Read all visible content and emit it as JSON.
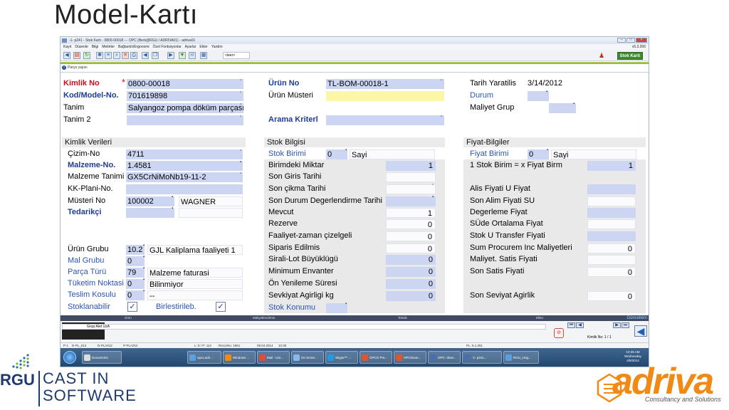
{
  "slide": {
    "title": "Model-Kartı"
  },
  "window": {
    "title": "-1- p241 - Stok Kartı - 0800-00018 --- OPC (Berk@RGU / ADRIVA01) - adriva01",
    "version": "v5.3.266",
    "menus": [
      "Kayıt",
      "Düzenle",
      "Bilgi",
      "Metinler",
      "Bağlantılı/Ergonomi",
      "Özel Fonksiyonlar",
      "Ayarlar",
      "Ekler",
      "Yardım"
    ],
    "toolbar_select": "<leer>",
    "stok_karti_button": "Stok Karti",
    "breadcrumb": "Parça yapısı"
  },
  "header": {
    "kimlik_no_label": "Kimlik No",
    "kimlik_no_req": "*",
    "kimlik_no": "0800-00018",
    "kod_model_label": "Kod/Model-No.",
    "kod_model": "701619898",
    "tanim_label": "Tanim",
    "tanim": "Salyangoz pompa döküm parçası",
    "tanim2_label": "Tanim 2",
    "tanim2": "",
    "urun_no_label": "Ürün No",
    "urun_no": "TL-BOM-00018-1",
    "urun_musteri_label": "Ürün Müsteri",
    "urun_musteri": "",
    "arama_label": "Arama Kriterl",
    "arama": "",
    "tarih_label": "Tarih Yaratilis",
    "tarih": "3/14/2012",
    "durum_label": "Durum",
    "durum": "",
    "maliyet_grup_label": "Maliyet Grup",
    "maliyet_grup": ""
  },
  "kimlik_verileri": {
    "title": "Kimlik Verileri",
    "cizim_label": "Çizim-No",
    "cizim": "4711",
    "malzeme_no_label": "Malzeme-No.",
    "malzeme_no": "1.4581",
    "malzeme_tanim_label": "Malzeme Tanimi",
    "malzeme_tanim": "GX5CrNiMoNb19-11-2",
    "kk_plani_label": "KK-Plani-No.",
    "kk_plani": "",
    "musteri_no_label": "Müsteri No",
    "musteri_no": "100002",
    "musteri_name": "WAGNER",
    "tedarikci_label": "Tedarikçi",
    "tedarikci": "",
    "urun_grubu_label": "Ürün Grubu",
    "urun_grubu_code": "10.2",
    "urun_grubu_desc": "GJL Kaliplama faaliyeti 1",
    "mal_grubu_label": "Mal Grubu",
    "mal_grubu": "0",
    "parca_turu_label": "Parça Türü",
    "parca_turu_code": "79",
    "parca_turu_desc": "Malzeme faturasi",
    "tuketim_label": "Tüketim Noktasi",
    "tuketim_code": "0",
    "tuketim_desc": "Bilinmiyor",
    "teslim_label": "Teslim Kosulu",
    "teslim_code": "0",
    "teslim_desc": "--",
    "stoklanabilir_label": "Stoklanabilir",
    "birlestirileb_label": "Birlestirileb.",
    "check_mark": "✓"
  },
  "stok_bilgisi": {
    "title": "Stok Bilgisi",
    "stok_birimi_label": "Stok Birimi",
    "stok_birimi_code": "0",
    "stok_birimi_desc": "Sayi",
    "rows": [
      {
        "label": "Birimdeki Miktar",
        "value": "1"
      },
      {
        "label": "Son Giris Tarihi",
        "value": ""
      },
      {
        "label": "Son çikma Tarihi",
        "value": ""
      },
      {
        "label": "Son Durum Degerlendirme Tarihi",
        "value": ""
      },
      {
        "label": "Mevcut",
        "value": "1"
      },
      {
        "label": "Rezerve",
        "value": "0"
      },
      {
        "label": "Faaliyet-zaman çizelgeli",
        "value": "0"
      },
      {
        "label": "Siparis Edilmis",
        "value": "0"
      },
      {
        "label": "Sirali-Lot Büyüklügü",
        "value": "0"
      },
      {
        "label": "Minimum Envanter",
        "value": "0"
      },
      {
        "label": "Ön Yenileme  Süresi",
        "value": "0"
      },
      {
        "label": "Sevkiyat Agirligi kg",
        "value": "0"
      }
    ],
    "stok_konumu_label": "Stok Konumu",
    "stok_konumu": ""
  },
  "fiyat_bilgiler": {
    "title": "Fiyat-Bilgiler",
    "fiyat_birimi_label": "Fiyat Birimi",
    "fiyat_birimi_code": "0",
    "fiyat_birimi_desc": "Sayi",
    "stok_fiyat_label": "1 Stok Birim = x Fiyat Birm",
    "stok_fiyat": "1",
    "alis_label": "Alis Fiyati U Fiyat",
    "son_alim_label": "Son Alim Fiyati SU",
    "degerleme_label": "Degerleme Fiyat",
    "sude_label": "SÜde Ortalama Fiyat",
    "transfer_label": "Stok U Transfer Fiyati",
    "sum_procurem_label": "Sum Procurem Inc Maliyetleri",
    "sum_procurem": "0",
    "maliyet_satis_label": "Maliyet. Satis Fiyati",
    "son_satis_label": "Son Satis Fiyati",
    "son_satis": "0",
    "son_sevkiyat_label": "Son Seviyat Agirlik",
    "son_sevkiyat": "0"
  },
  "tabs": {
    "urun": "Ürün",
    "maliyetlendirme": "Maliyetlendirme",
    "teknik": "Teknik",
    "ekler": "Ekler",
    "guncelleme": "Güncellem"
  },
  "lower": {
    "grup": "Grup:Alet UzA",
    "kimlik_no_counter": "Kimlik No: 1 / 1"
  },
  "statusbar": {
    "p1": "P-1",
    "d1": "D-PL_012",
    "d2": "D-PLA012",
    "d3": "P-PLA012",
    "pos": "L: 8 / P: 114",
    "recno": "RecorNo: 1961",
    "date": "09.04.2014",
    "time": "10:35",
    "pl": "PL: 5.1.261"
  },
  "taskbar": {
    "tasks": [
      "Documents",
      "opcs.adri...",
      "Windows ...",
      "Mail - Uni...",
      "On Scree...",
      "Skype™ ...",
      "OPCO Pre...",
      "OPCDoun...",
      "OPC- dsse...",
      "-1- p241...",
      "RGU_Ling..."
    ],
    "clock_time": "10:35 AM",
    "clock_day": "Wednesday",
    "clock_date": "4/9/2014"
  },
  "logos": {
    "rgu": "RGU",
    "cast_line1": "CAST IN",
    "cast_line2": "SOFTWARE",
    "adriva": "adriva",
    "adriva_sub": "Consultancy and Solutions"
  },
  "colors": {
    "field_blue": "#ccd6f2",
    "label_red": "#c8101f",
    "label_navy": "#1e3c96",
    "accent_orange": "#f08a14",
    "taskbar": "#2c5580"
  }
}
